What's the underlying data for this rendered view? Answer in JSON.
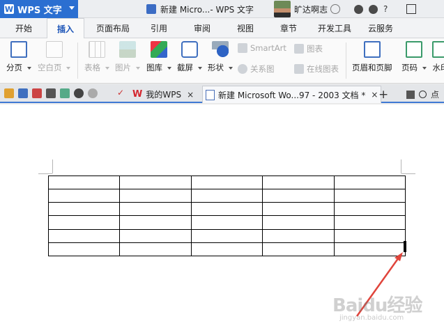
{
  "titlebar": {
    "app_label": "WPS 文字",
    "document_title": "新建 Micro...- WPS 文字",
    "user_name": "旷达啊志"
  },
  "tabs": [
    "开始",
    "插入",
    "页面布局",
    "引用",
    "审阅",
    "视图",
    "章节",
    "开发工具",
    "云服务"
  ],
  "active_tab": "插入",
  "ribbon": {
    "page_break": "分页",
    "blank_page": "空白页",
    "table": "表格",
    "picture": "图片",
    "gallery": "图库",
    "screenshot": "截屏",
    "shapes": "形状",
    "smartart": "SmartArt",
    "chart": "图表",
    "relation_chart": "关系图",
    "online_chart": "在线图表",
    "header_footer": "页眉和页脚",
    "page_number": "页码",
    "watermark": "水印"
  },
  "doc_tabs": {
    "mywps": "我的WPS",
    "current": "新建 Microsoft Wo...97 - 2003 文档 *",
    "close": "×",
    "new_tab": "+",
    "right_label": "点"
  },
  "table": {
    "rows": 6,
    "cols": 5
  },
  "watermark": {
    "text": "Baidu经验",
    "sub": "jingyan.baidu.com"
  },
  "colors": {
    "accent": "#2b6fd1",
    "arrow": "#e0443b"
  }
}
